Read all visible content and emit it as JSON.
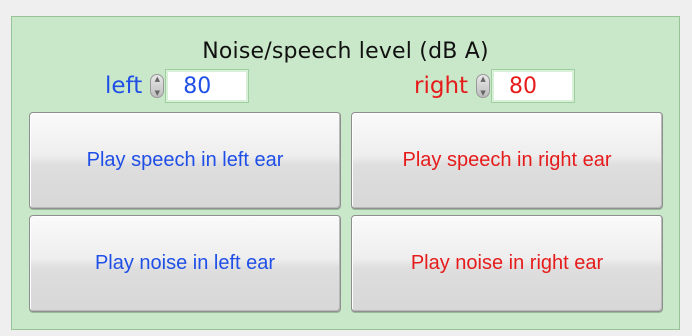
{
  "panel": {
    "title": "Noise/speech level (dB A)"
  },
  "levels": {
    "left": {
      "label": "left",
      "value": "80"
    },
    "right": {
      "label": "right",
      "value": "80"
    }
  },
  "buttons": {
    "speech_left": "Play speech in left ear",
    "speech_right": "Play speech in right ear",
    "noise_left": "Play noise in left ear",
    "noise_right": "Play noise in right ear"
  },
  "colors": {
    "panel_bg": "#c9e8c9",
    "left_text": "#1f4fe6",
    "right_text": "#e61b1b"
  },
  "icons": {
    "spinner": "up-down-spinner-icon"
  }
}
